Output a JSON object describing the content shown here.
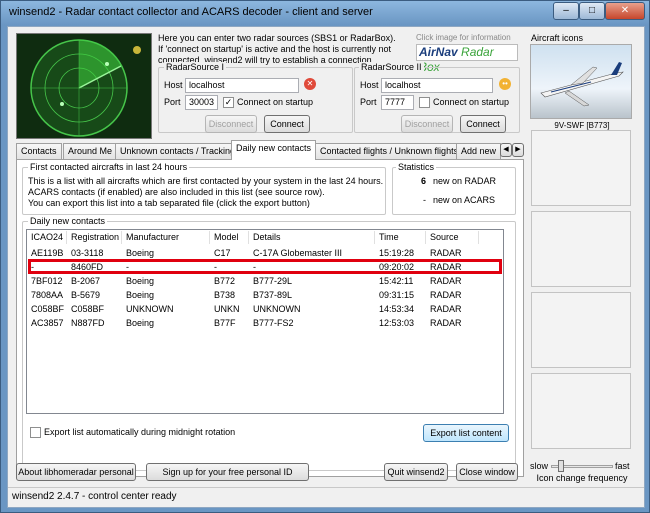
{
  "window": {
    "title": "winsend2 - Radar contact collector and ACARS decoder - client and server"
  },
  "intro": {
    "text_lines": [
      "Here you can enter two radar sources (SBS1 or RadarBox).",
      "If 'connect on startup' is active and the host is currently not",
      "connected, winsend2 will try to establish a connection."
    ],
    "logo_hint": "Click image for information",
    "logo_text_1": "AirNav",
    "logo_text_2": "Radar Box"
  },
  "source1": {
    "title": "RadarSource I",
    "host_label": "Host",
    "host_value": "localhost",
    "port_label": "Port",
    "port_value": "30003",
    "connect_on_startup": "Connect on startup",
    "checked": true,
    "disconnect_label": "Disconnect",
    "connect_label": "Connect"
  },
  "source2": {
    "title": "RadarSource II",
    "host_label": "Host",
    "host_value": "localhost",
    "port_label": "Port",
    "port_value": "7777",
    "connect_on_startup": "Connect on startup",
    "checked": false,
    "disconnect_label": "Disconnect",
    "connect_label": "Connect"
  },
  "aircraft_icons": {
    "title": "Aircraft icons",
    "caption": "9V-SWF [B773]"
  },
  "tabs": [
    "Contacts",
    "Around Me",
    "Unknown contacts / Tracking",
    "Daily new contacts",
    "Contacted flights / Unknown flights",
    "Add new"
  ],
  "active_tab": 3,
  "daily": {
    "group_title": "First contacted aircrafts in last 24 hours",
    "desc_lines": [
      "This is a list with all aircrafts which are first contacted by your system in the last 24 hours.",
      "ACARS contacts (if enabled) are also included in this list (see source row).",
      "You can export this list into a tab separated file (click the export button)"
    ],
    "stats_title": "Statistics",
    "stats": [
      {
        "value": "6",
        "label": "new on RADAR"
      },
      {
        "value": "-",
        "label": "new on ACARS"
      }
    ],
    "list_title": "Daily new contacts",
    "columns": [
      "ICAO24",
      "Registration",
      "Manufacturer",
      "Model",
      "Details",
      "Time",
      "Source"
    ],
    "rows": [
      [
        "AE119B",
        "03-3118",
        "Boeing",
        "C17",
        "C-17A Globemaster III",
        "15:19:28",
        "RADAR"
      ],
      [
        "-",
        "8460FD",
        "-",
        "-",
        "-",
        "09:20:02",
        "RADAR"
      ],
      [
        "7BF012",
        "B-2067",
        "Boeing",
        "B772",
        "B777-29L",
        "15:42:11",
        "RADAR"
      ],
      [
        "7808AA",
        "B-5679",
        "Boeing",
        "B738",
        "B737-89L",
        "09:31:15",
        "RADAR"
      ],
      [
        "C058BF",
        "C058BF",
        "UNKNOWN",
        "UNKN",
        "UNKNOWN",
        "14:53:34",
        "RADAR"
      ],
      [
        "AC3857",
        "N887FD",
        "Boeing",
        "B77F",
        "B777-FS2",
        "12:53:03",
        "RADAR"
      ]
    ],
    "export_auto_label": "Export list automatically during midnight rotation",
    "export_button": "Export list content"
  },
  "bottom": {
    "about_button": "About libhomeradar personal",
    "signup_button": "Sign up for your free personal ID",
    "quit_button": "Quit winsend2",
    "close_button": "Close window",
    "slow_label": "slow",
    "fast_label": "fast",
    "freq_label": "Icon change frequency"
  },
  "status": "winsend2 2.4.7 - control center ready",
  "colors": {
    "highlight": "#e0000f",
    "radar_green": "#3fd13f",
    "title_blue": "#6a96c3"
  }
}
